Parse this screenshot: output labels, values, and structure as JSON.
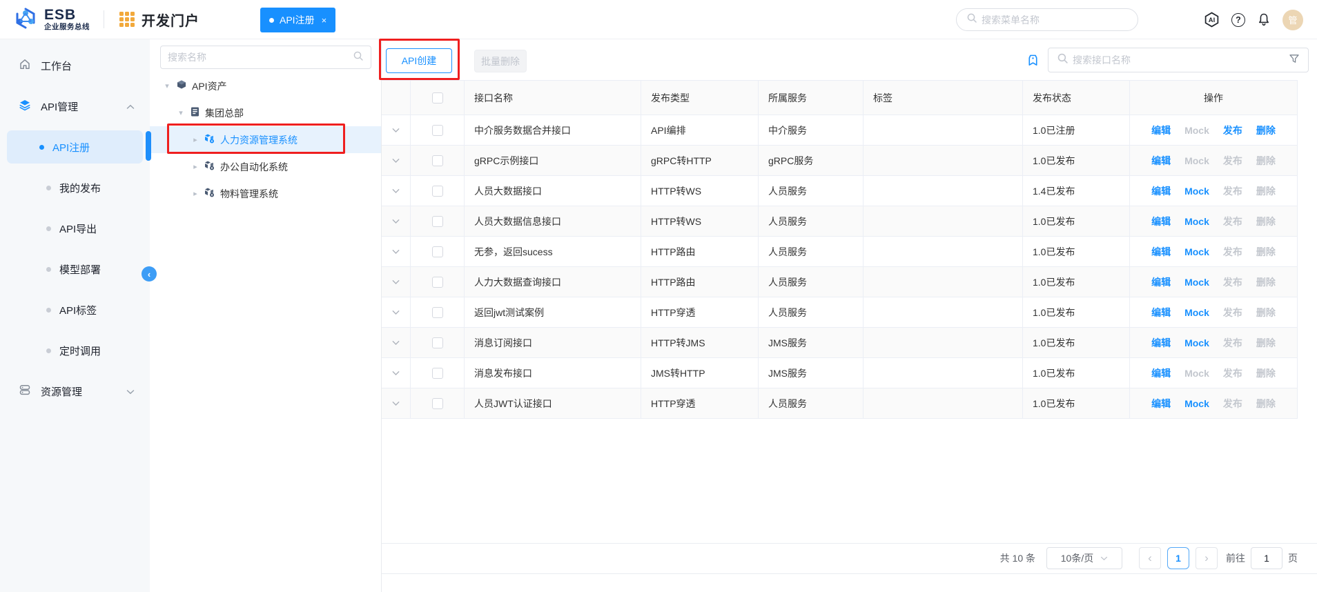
{
  "colors": {
    "accent": "#1890ff",
    "annotation_red": "#ef1f1f",
    "header_tab_bg": "#1890ff"
  },
  "header": {
    "logo_title": "ESB",
    "logo_subtitle": "企业服务总线",
    "portal_title": "开发门户",
    "tab": {
      "label": "API注册",
      "close": "×"
    },
    "menu_search_placeholder": "搜索菜单名称",
    "avatar_text": "管"
  },
  "sidebar": {
    "workbench": "工作台",
    "api_mgmt": "API管理",
    "sub_items": [
      {
        "label": "API注册",
        "active": true
      },
      {
        "label": "我的发布",
        "active": false
      },
      {
        "label": "API导出",
        "active": false
      },
      {
        "label": "模型部署",
        "active": false
      },
      {
        "label": "API标签",
        "active": false
      },
      {
        "label": "定时调用",
        "active": false
      }
    ],
    "resource_mgmt": "资源管理"
  },
  "tree": {
    "search_placeholder": "搜索名称",
    "nodes": [
      {
        "label": "API资产",
        "icon": "cube-icon",
        "expanded": true
      },
      {
        "label": "集团总部",
        "icon": "document-icon",
        "expanded": true
      },
      {
        "label": "人力资源管理系统",
        "icon": "system-cube-icon",
        "selected": true
      },
      {
        "label": "办公自动化系统",
        "icon": "system-cube-icon",
        "selected": false
      },
      {
        "label": "物料管理系统",
        "icon": "system-cube-icon",
        "selected": false
      }
    ]
  },
  "toolbar": {
    "create_button": "API创建",
    "batch_delete_button": "批量删除",
    "interface_search_placeholder": "搜索接口名称"
  },
  "table": {
    "columns": {
      "name": "接口名称",
      "publish_type": "发布类型",
      "service": "所属服务",
      "tag": "标签",
      "status": "发布状态",
      "action": "操作"
    },
    "action_labels": {
      "edit": "编辑",
      "mock": "Mock",
      "publish": "发布",
      "delete": "删除"
    },
    "rows": [
      {
        "name": "中介服务数据合并接口",
        "type": "API编排",
        "service": "中介服务",
        "tag": "",
        "status": "1.0已注册",
        "enabled": {
          "edit": true,
          "mock": false,
          "publish": true,
          "delete": true
        }
      },
      {
        "name": "gRPC示例接口",
        "type": "gRPC转HTTP",
        "service": "gRPC服务",
        "tag": "",
        "status": "1.0已发布",
        "enabled": {
          "edit": true,
          "mock": false,
          "publish": false,
          "delete": false
        }
      },
      {
        "name": "人员大数据接口",
        "type": "HTTP转WS",
        "service": "人员服务",
        "tag": "",
        "status": "1.4已发布",
        "enabled": {
          "edit": true,
          "mock": true,
          "publish": false,
          "delete": false
        }
      },
      {
        "name": "人员大数据信息接口",
        "type": "HTTP转WS",
        "service": "人员服务",
        "tag": "",
        "status": "1.0已发布",
        "enabled": {
          "edit": true,
          "mock": true,
          "publish": false,
          "delete": false
        }
      },
      {
        "name": "无参，返回sucess",
        "type": "HTTP路由",
        "service": "人员服务",
        "tag": "",
        "status": "1.0已发布",
        "enabled": {
          "edit": true,
          "mock": true,
          "publish": false,
          "delete": false
        }
      },
      {
        "name": "人力大数据查询接口",
        "type": "HTTP路由",
        "service": "人员服务",
        "tag": "",
        "status": "1.0已发布",
        "enabled": {
          "edit": true,
          "mock": true,
          "publish": false,
          "delete": false
        }
      },
      {
        "name": "返回jwt测试案例",
        "type": "HTTP穿透",
        "service": "人员服务",
        "tag": "",
        "status": "1.0已发布",
        "enabled": {
          "edit": true,
          "mock": true,
          "publish": false,
          "delete": false
        }
      },
      {
        "name": "消息订阅接口",
        "type": "HTTP转JMS",
        "service": "JMS服务",
        "tag": "",
        "status": "1.0已发布",
        "enabled": {
          "edit": true,
          "mock": true,
          "publish": false,
          "delete": false
        }
      },
      {
        "name": "消息发布接口",
        "type": "JMS转HTTP",
        "service": "JMS服务",
        "tag": "",
        "status": "1.0已发布",
        "enabled": {
          "edit": true,
          "mock": false,
          "publish": false,
          "delete": false
        }
      },
      {
        "name": "人员JWT认证接口",
        "type": "HTTP穿透",
        "service": "人员服务",
        "tag": "",
        "status": "1.0已发布",
        "enabled": {
          "edit": true,
          "mock": true,
          "publish": false,
          "delete": false
        }
      }
    ]
  },
  "pagination": {
    "total_text": "共 10 条",
    "page_size": "10条/页",
    "current_page": "1",
    "goto_label": "前往",
    "goto_value": "1",
    "goto_unit": "页"
  }
}
